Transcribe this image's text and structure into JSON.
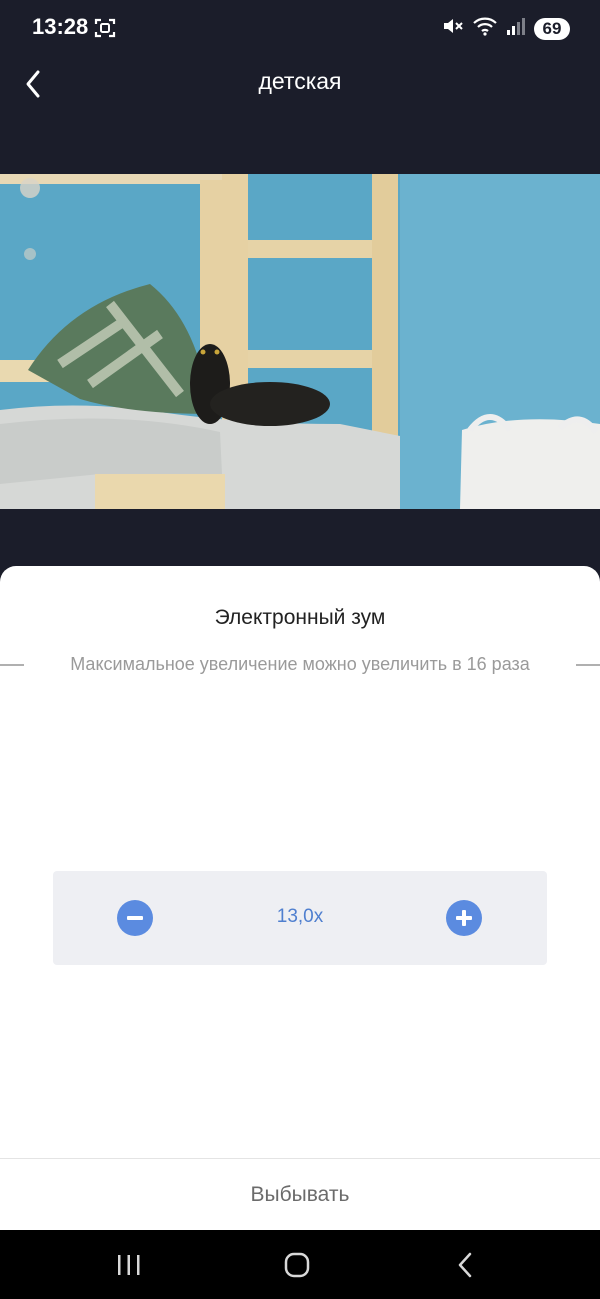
{
  "status_bar": {
    "time": "13:28",
    "battery": "69",
    "icons": [
      "screenshot-icon",
      "mute-icon",
      "wifi-icon",
      "signal-icon"
    ]
  },
  "header": {
    "title": "детская",
    "back_icon": "chevron-left-icon"
  },
  "camera": {
    "description_icon": "camera-feed"
  },
  "zoom_sheet": {
    "title": "Электронный зум",
    "subtitle": "Максимальное увеличение можно увеличить в 16 раза",
    "zoom_value": "13,0x",
    "accent_color": "#5b8be0",
    "action_label": "Выбывать"
  },
  "nav_bar": {
    "items": [
      "recent-apps-icon",
      "home-icon",
      "back-icon"
    ]
  }
}
